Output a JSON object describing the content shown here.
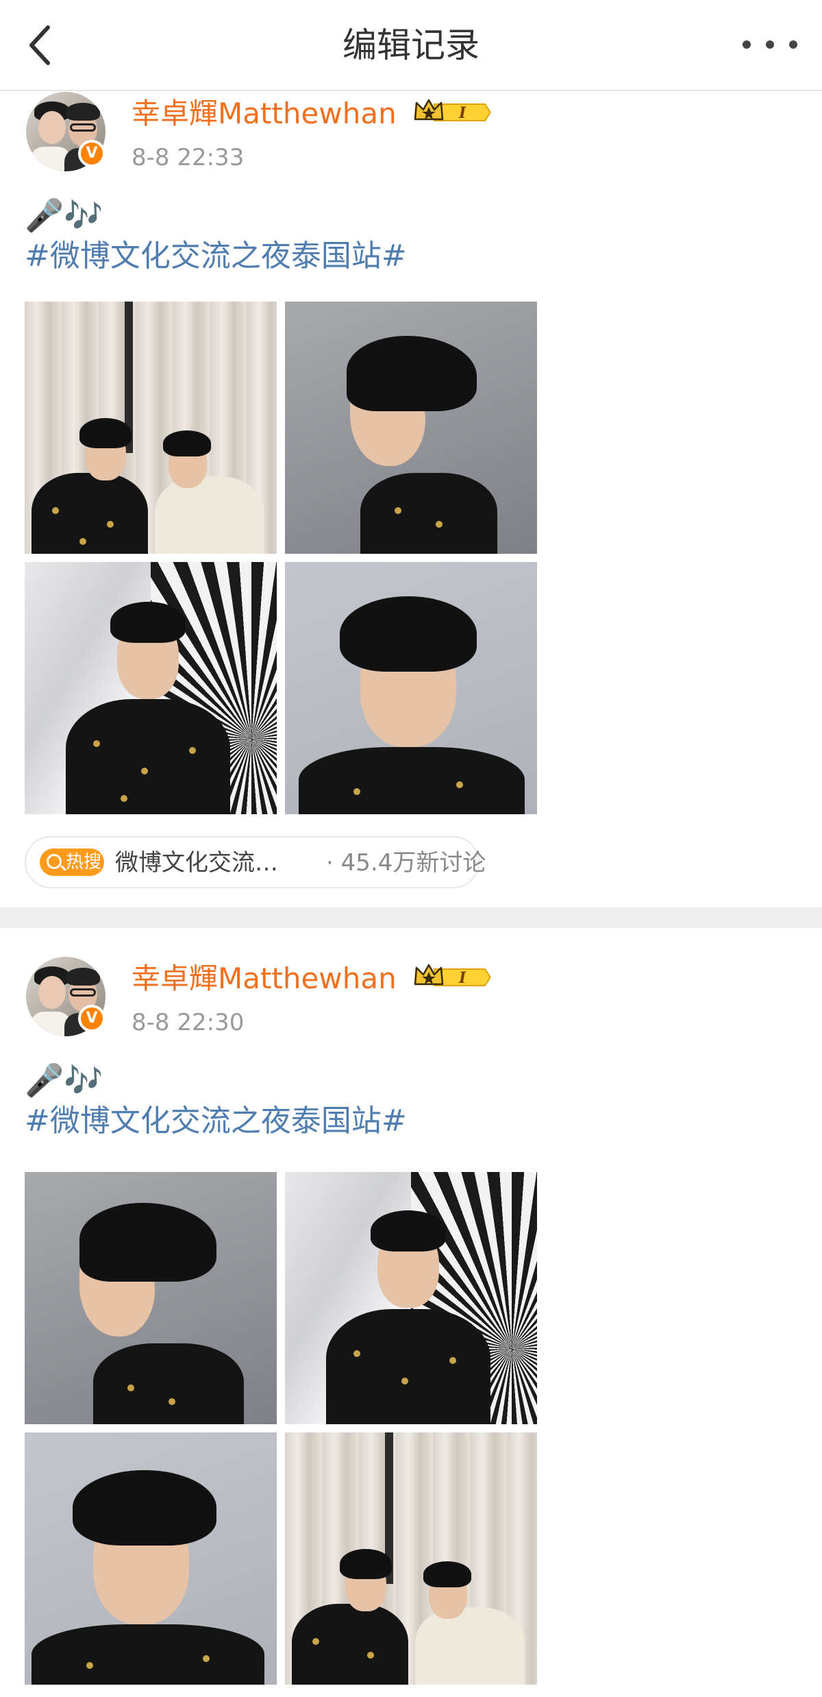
{
  "nav": {
    "title": "编辑记录"
  },
  "posts": [
    {
      "username": "幸卓輝Matthewhan",
      "time": "8-8 22:33",
      "emojis": "🎤🎶",
      "hashtag": "#微博文化交流之夜泰国站#",
      "hot": {
        "tag": "热搜",
        "text": "微博文化交流…",
        "count": "· 45.4万新讨论"
      }
    },
    {
      "username": "幸卓輝Matthewhan",
      "time": "8-8 22:30",
      "emojis": "🎤🎶",
      "hashtag": "#微博文化交流之夜泰国站#"
    }
  ],
  "vip_level": "I",
  "verified_mark": "V",
  "colors": {
    "username": "#f0701f",
    "hashtag": "#507daf",
    "hot_tag": "#ff9a1a",
    "verified": "#ff8200"
  },
  "icons": [
    "back-icon",
    "more-icon",
    "vip-crown-icon",
    "verified-icon",
    "hot-search-icon"
  ]
}
